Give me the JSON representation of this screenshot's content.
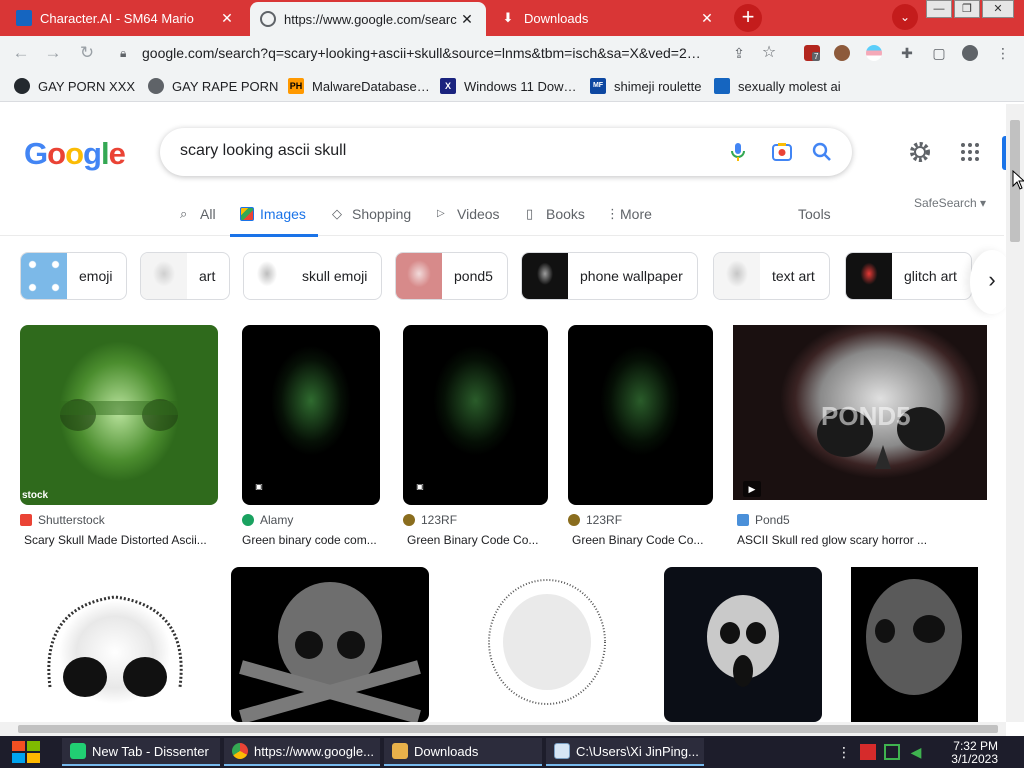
{
  "browser": {
    "tabs": [
      {
        "title": "Character.AI - SM64 Mario",
        "close": "✕"
      },
      {
        "title": "https://www.google.com/searc",
        "close": "✕"
      },
      {
        "title": "Downloads",
        "close": "✕"
      }
    ],
    "new_tab": "+",
    "tab_search": "⌄",
    "window": {
      "minimize": "—",
      "restore": "❐",
      "close": "✕"
    },
    "url": "google.com/search?q=scary+looking+ascii+skull&source=lnms&tbm=isch&sa=X&ved=2…",
    "extension_badge": "7"
  },
  "bookmarks": [
    {
      "label": "GAY PORN XXX",
      "icon": "github-icon"
    },
    {
      "label": "GAY RAPE PORN",
      "icon": "globe-icon"
    },
    {
      "label": "MalwareDatabase…",
      "icon": "ph-icon",
      "icon_text": "PH"
    },
    {
      "label": "Windows 11 Dow…",
      "icon": "x-icon",
      "icon_text": "X"
    },
    {
      "label": "shimeji roulette",
      "icon": "mf-icon",
      "icon_text": "MF"
    },
    {
      "label": "sexually molest ai",
      "icon": "cai-icon"
    }
  ],
  "google": {
    "logo": [
      "G",
      "o",
      "o",
      "g",
      "l",
      "e"
    ],
    "logo_colors": [
      "#4285f4",
      "#ea4335",
      "#fbbc05",
      "#4285f4",
      "#34a853",
      "#ea4335"
    ],
    "query": "scary looking ascii skull",
    "tabs": [
      {
        "label": "All",
        "icon": "search-icon"
      },
      {
        "label": "Images",
        "icon": "image-icon"
      },
      {
        "label": "Shopping",
        "icon": "tag-icon"
      },
      {
        "label": "Videos",
        "icon": "play-icon"
      },
      {
        "label": "Books",
        "icon": "book-icon"
      },
      {
        "label": "More",
        "icon": "more-vert-icon"
      }
    ],
    "tools": "Tools",
    "safesearch": "SafeSearch ▾",
    "chips": [
      "emoji",
      "art",
      "skull emoji",
      "pond5",
      "phone wallpaper",
      "text art",
      "glitch art"
    ],
    "results_row1": [
      {
        "source": "Shutterstock",
        "caption": "Scary Skull Made Distorted Ascii...",
        "source_color": "#ea4335"
      },
      {
        "source": "Alamy",
        "caption": "Green binary code com...",
        "source_color": "#1aa260"
      },
      {
        "source": "123RF",
        "caption": "Green Binary Code Co...",
        "source_color": "#8a6d1e"
      },
      {
        "source": "123RF",
        "caption": "Green Binary Code Co...",
        "source_color": "#8a6d1e"
      },
      {
        "source": "Pond5",
        "caption": "ASCII Skull red glow scary horror ...",
        "source_color": "#4a90d9"
      }
    ],
    "watermark_stock": "stock",
    "watermark_pond5": "POND5"
  },
  "taskbar": {
    "items": [
      "New Tab - Dissenter",
      "https://www.google...",
      "Downloads",
      "C:\\Users\\Xi JinPing..."
    ],
    "time": "7:32 PM",
    "date": "3/1/2023"
  },
  "colors": {
    "tabstrip": "#d93636",
    "accent": "#1a73e8",
    "taskbar": "#1d1d2b"
  }
}
